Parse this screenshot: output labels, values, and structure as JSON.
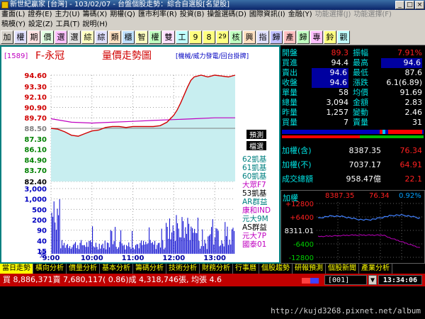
{
  "window": {
    "title": "新世紀贏家 [台灣] - 103/02/07 - 台盤個股走勢：綜合自選股[名望股]"
  },
  "menu1": [
    "畫面(L)",
    "證券(E)",
    "主力(U)",
    "籌碼(X)",
    "期權(Q)",
    "匯市利率(R)",
    "投資(B)",
    "操盤選碼(D)",
    "國際資訊(I)",
    "金融(Y)",
    "功能選擇(J)",
    "功能選擇(F)"
  ],
  "menu2": [
    "稿模(Y)",
    "設定(Z)",
    "工具(T)",
    "說明(H)"
  ],
  "toolbar": [
    "加",
    "權",
    "期",
    "價",
    "選",
    "選",
    "綜",
    "綜",
    "類",
    "櫃",
    "智",
    "權",
    "雙",
    "工",
    "9",
    "8",
    "29",
    "核",
    "興",
    "指",
    "歸",
    "產",
    "歸",
    "專",
    "鈴",
    "觀"
  ],
  "chart": {
    "stock_code": "[1589]",
    "stock_name": "F-永冠",
    "chart_title": "量價走勢圖",
    "sub_info": "[機械/威力發電/回台掛牌]",
    "price_ticks": [
      "94.60",
      "93.30",
      "92.10",
      "90.90",
      "89.70",
      "88.50",
      "87.30",
      "86.10",
      "84.90",
      "83.70",
      "82.40"
    ],
    "ref_price_label": "88.50",
    "volume_ticks": [
      "3,000",
      "1,000",
      "500",
      "200",
      "90",
      "40",
      "15"
    ],
    "volume_unit": "張",
    "time_ticks": [
      "9:00",
      "10:00",
      "11:00",
      "12:00",
      "13:00"
    ],
    "legend_tags": [
      "預測",
      "檔選"
    ],
    "brokers": [
      {
        "text": "62凱基",
        "color": "#008080"
      },
      {
        "text": "61凱基",
        "color": "#008080"
      },
      {
        "text": "60凱基",
        "color": "#008080"
      },
      {
        "text": "大眾F7",
        "color": "#c000c0"
      },
      {
        "text": "53凱基",
        "color": "#000000"
      },
      {
        "text": "AR群益",
        "color": "#008080"
      },
      {
        "text": "康和IND",
        "color": "#c000c0"
      },
      {
        "text": "元大9M",
        "color": "#008080"
      },
      {
        "text": "AS群益",
        "color": "#000000"
      },
      {
        "text": "元大7P",
        "color": "#c000c0"
      },
      {
        "text": "國泰01",
        "color": "#c000c0"
      }
    ]
  },
  "chart_data": {
    "type": "line",
    "title": "量價走勢圖",
    "x_ticks": [
      "9:00",
      "10:00",
      "11:00",
      "12:00",
      "13:00"
    ],
    "ylim": [
      82.4,
      94.6
    ],
    "reference": 88.5,
    "price_series": [
      [
        "9:00",
        88.5
      ],
      [
        "9:10",
        88.4
      ],
      [
        "9:20",
        88.1
      ],
      [
        "9:30",
        87.7
      ],
      [
        "9:40",
        87.6
      ],
      [
        "9:50",
        87.9
      ],
      [
        "10:00",
        88.2
      ],
      [
        "10:10",
        88.3
      ],
      [
        "10:20",
        88.6
      ],
      [
        "10:30",
        88.7
      ],
      [
        "10:40",
        88.7
      ],
      [
        "10:50",
        88.6
      ],
      [
        "11:00",
        88.7
      ],
      [
        "11:10",
        88.7
      ],
      [
        "11:20",
        88.7
      ],
      [
        "11:30",
        88.7
      ],
      [
        "11:40",
        88.8
      ],
      [
        "11:50",
        89.2
      ],
      [
        "12:00",
        90.0
      ],
      [
        "12:05",
        90.6
      ],
      [
        "12:10",
        91.4
      ],
      [
        "12:15",
        92.3
      ],
      [
        "12:20",
        93.2
      ],
      [
        "12:25",
        94.0
      ],
      [
        "12:30",
        94.4
      ],
      [
        "12:40",
        94.6
      ],
      [
        "12:50",
        94.4
      ],
      [
        "13:00",
        94.6
      ],
      [
        "13:10",
        94.5
      ],
      [
        "13:20",
        94.4
      ],
      [
        "13:30",
        94.6
      ]
    ],
    "avg_series": [
      [
        "9:00",
        89.6
      ],
      [
        "9:30",
        89.2
      ],
      [
        "10:00",
        89.1
      ],
      [
        "10:30",
        89.2
      ],
      [
        "11:00",
        89.3
      ],
      [
        "11:30",
        89.4
      ],
      [
        "12:00",
        89.5
      ],
      [
        "12:30",
        89.6
      ],
      [
        "13:00",
        89.7
      ],
      [
        "13:30",
        89.7
      ]
    ]
  },
  "quote": {
    "rows": [
      {
        "l1": "開盤",
        "v1": "89.3",
        "c1": "red",
        "l2": "振幅",
        "v2": "7.91%",
        "c2": "red",
        "b2": false
      },
      {
        "l1": "買進",
        "v1": "94.4",
        "c1": "white",
        "l2": "最高",
        "v2": "94.6",
        "c2": "white",
        "b2": true
      },
      {
        "l1": "賣出",
        "v1": "94.6",
        "c1": "white",
        "b1": true,
        "l2": "最低",
        "v2": "87.6",
        "c2": "white",
        "b2": false
      },
      {
        "l1": "收盤",
        "v1": "94.6",
        "c1": "white",
        "b1": true,
        "l2": "漲跌",
        "v2": "6.1(6.89)",
        "c2": "white",
        "b2": false
      },
      {
        "l1": "單量",
        "v1": "58",
        "c1": "white",
        "l2": "均價",
        "v2": "91.69",
        "c2": "white",
        "b2": false
      },
      {
        "l1": "總量",
        "v1": "3,094",
        "c1": "white",
        "l2": "金額",
        "v2": "2.83",
        "c2": "white",
        "b2": false
      },
      {
        "l1": "昨量",
        "v1": "1,257",
        "c1": "white",
        "l2": "變動",
        "v2": "2.46",
        "c2": "white",
        "b2": false
      },
      {
        "l1": "買量",
        "v1": "7",
        "c1": "white",
        "l2": "賣量",
        "v2": "31",
        "c2": "white",
        "b2": false
      }
    ]
  },
  "index": {
    "rows": [
      {
        "label": "加權(含)",
        "value": "8387.35",
        "change": "76.34"
      },
      {
        "label": "加權(不)",
        "value": "7037.17",
        "change": "64.91"
      },
      {
        "label": "成交總額",
        "value": "958.47億",
        "change": "22.1"
      }
    ],
    "mini_label": "加權",
    "mini_value": "8387.35",
    "mini_change": "76.34",
    "mini_pct": "0.92%",
    "mini_ticks": [
      "+12800",
      "+6400",
      "8311.01",
      "-6400",
      "-12800"
    ]
  },
  "tabs": [
    "當日走勢",
    "橫向分析",
    "價量分析",
    "基本分析",
    "籌碼分析",
    "技術分析",
    "財務分析",
    "行事曆",
    "個股趨勢",
    "研報預測",
    "個股新聞",
    "產業分析"
  ],
  "status": {
    "text": "買 8,886,371賣 7,680,117( 0.86)成 4,318,746張, 均張 4.6",
    "counter": "001",
    "clock": "13:34:06"
  },
  "watermark": "http://kujd3268.pixnet.net/album",
  "colors": {
    "price_line": "#d00000",
    "avg_line": "#c000c0",
    "fill": "#c8eef0",
    "volume": "#0000d0",
    "accent_teal": "#008080"
  }
}
